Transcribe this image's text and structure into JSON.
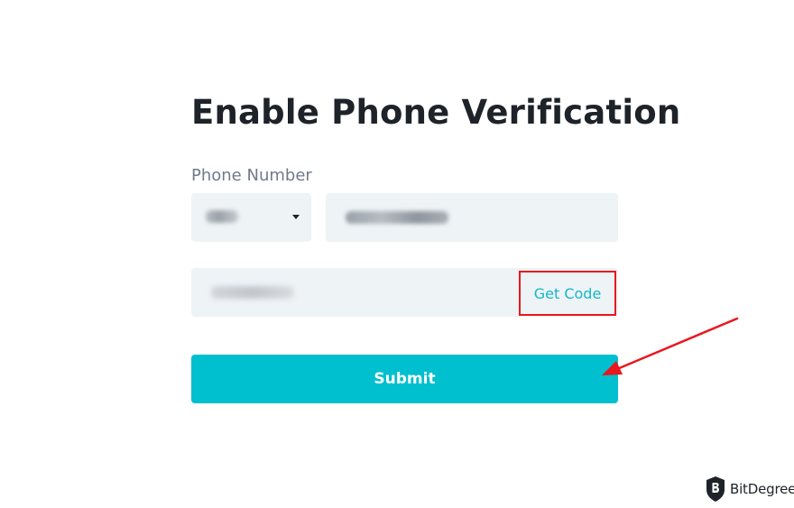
{
  "form": {
    "title": "Enable Phone Verification",
    "phone_label": "Phone Number",
    "get_code_label": "Get Code",
    "submit_label": "Submit"
  },
  "annotation": {
    "highlight_color": "#e8181e",
    "arrow_color": "#e8181e"
  },
  "watermark": {
    "brand": "BitDegree",
    "icon": "bitdegree-shield-icon"
  },
  "colors": {
    "accent": "#00bfcf",
    "link": "#13b8c8",
    "field_bg": "#eef3f6",
    "title": "#1e2329",
    "label": "#707a8a"
  }
}
